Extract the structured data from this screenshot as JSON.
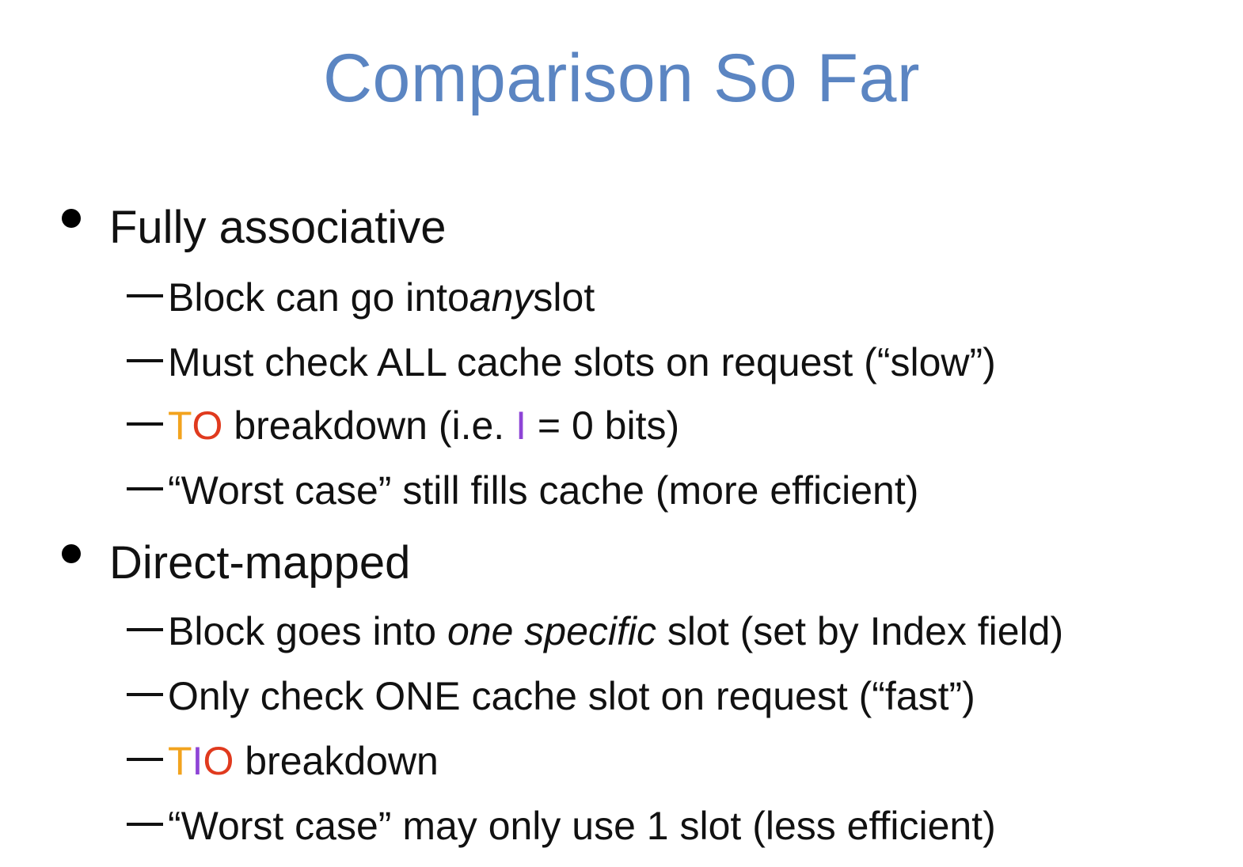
{
  "slide": {
    "title": "Comparison So Far",
    "sections": [
      {
        "heading": "Fully associative",
        "items": [
          {
            "before": "Block can go into ",
            "italic": "any",
            "after": " slot"
          },
          {
            "text": "Must check ALL cache slots on request (“slow”)"
          },
          {
            "tag_t": "T",
            "tag_o": "O",
            "after": " breakdown (i.e. ",
            "tag_i": "I",
            "after2": " = 0 bits)"
          },
          {
            "text": "“Worst case” still fills cache (more efficient)"
          }
        ]
      },
      {
        "heading": "Direct-mapped",
        "items": [
          {
            "before": "Block goes into ",
            "italic": "one specific",
            "after": " slot (set by Index field)"
          },
          {
            "text": "Only check ONE cache slot on request (“fast”)"
          },
          {
            "tag_t": "T",
            "tag_i": "I",
            "tag_o": "O",
            "after": " breakdown"
          },
          {
            "text": "“Worst case” may only use 1 slot (less efficient)"
          }
        ]
      }
    ]
  },
  "colors": {
    "title": "#5b85c2",
    "tag_t": "#f2a31e",
    "tag_i": "#8e44d6",
    "tag_o": "#e03a1e"
  }
}
